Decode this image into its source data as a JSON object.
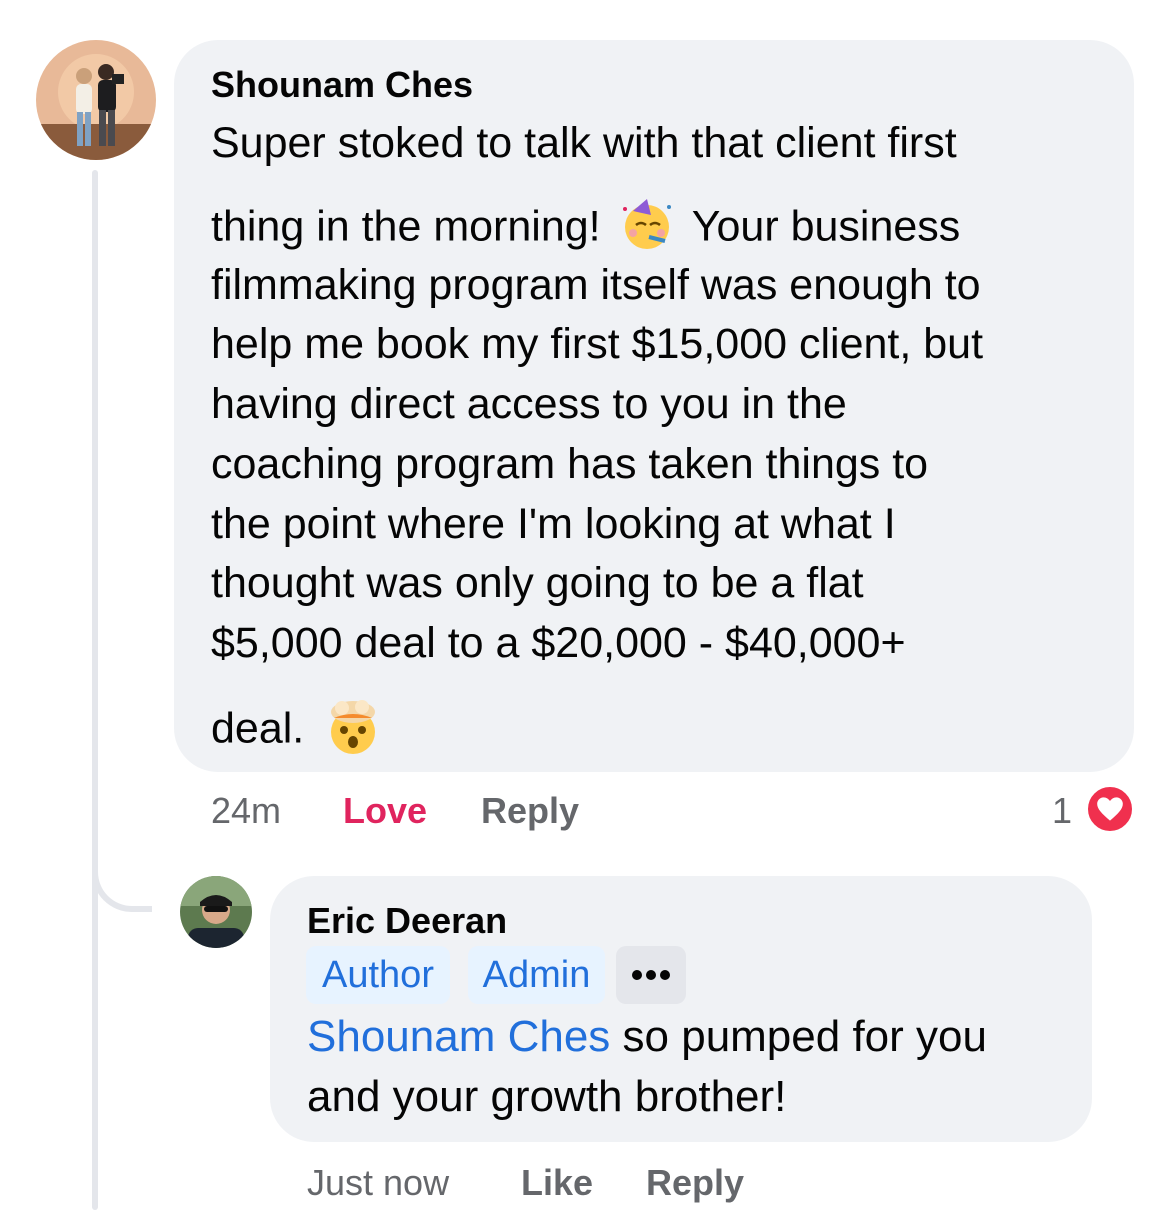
{
  "comment": {
    "author": "Shounam Ches",
    "lines": [
      "Super stoked to talk with that client first",
      "thing in the morning!",
      "Your business",
      "filmmaking program itself was enough to",
      "help me book my first $15,000 client, but",
      "having direct access to you in the",
      "coaching program has taken things to",
      "the point where I'm looking at what I",
      "thought was only going to be a flat",
      "$5,000 deal to a $20,000 - $40,000+",
      "deal."
    ],
    "emojis": [
      "partying-face-emoji",
      "exploding-head-emoji"
    ],
    "time": "24m",
    "reaction_action": "Love",
    "reply_action": "Reply",
    "reaction_count": "1",
    "reaction_icon": "heart-icon"
  },
  "reply": {
    "author": "Eric Deeran",
    "badges": [
      "Author",
      "Admin"
    ],
    "mention": "Shounam Ches",
    "text_line1": " so pumped for you",
    "text_line2": "and your growth brother!",
    "time": "Just now",
    "like_action": "Like",
    "reply_action": "Reply"
  },
  "colors": {
    "bubble": "#f0f2f5",
    "link": "#216fdb",
    "love": "#e0245e",
    "secondary_text": "#65676b"
  }
}
